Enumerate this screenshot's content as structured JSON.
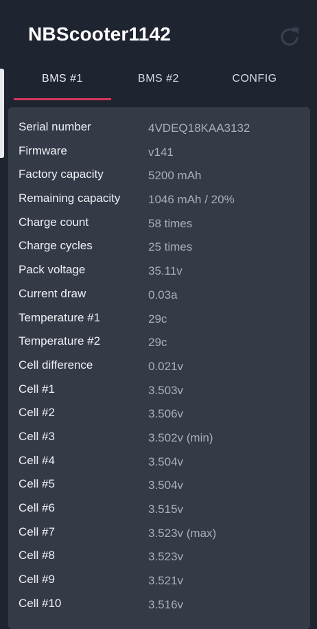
{
  "app": {
    "title": "NBScooter1142"
  },
  "header": {
    "refresh_icon": "refresh-icon"
  },
  "tabs": [
    {
      "label": "BMS #1",
      "active": true
    },
    {
      "label": "BMS #2",
      "active": false
    },
    {
      "label": "CONFIG",
      "active": false
    }
  ],
  "colors": {
    "background": "#1f2431",
    "card": "#353a47",
    "accent": "#d8385a",
    "label_text": "#eef0f4",
    "value_text": "#a9aeb9"
  },
  "bms": {
    "rows": [
      {
        "label": "Serial number",
        "value": "4VDEQ18KAA3132"
      },
      {
        "label": "Firmware",
        "value": "v141"
      },
      {
        "label": "Factory capacity",
        "value": "5200 mAh"
      },
      {
        "label": "Remaining capacity",
        "value": "1046 mAh / 20%"
      },
      {
        "label": "Charge count",
        "value": "58 times"
      },
      {
        "label": "Charge cycles",
        "value": "25 times"
      },
      {
        "label": "Pack voltage",
        "value": "35.11v"
      },
      {
        "label": "Current draw",
        "value": "0.03a"
      },
      {
        "label": "Temperature #1",
        "value": "29c"
      },
      {
        "label": "Temperature #2",
        "value": "29c"
      },
      {
        "label": "Cell difference",
        "value": "0.021v"
      },
      {
        "label": "Cell #1",
        "value": "3.503v"
      },
      {
        "label": "Cell #2",
        "value": "3.506v"
      },
      {
        "label": "Cell #3",
        "value": "3.502v (min)"
      },
      {
        "label": "Cell #4",
        "value": "3.504v"
      },
      {
        "label": "Cell #5",
        "value": "3.504v"
      },
      {
        "label": "Cell #6",
        "value": "3.515v"
      },
      {
        "label": "Cell #7",
        "value": "3.523v (max)"
      },
      {
        "label": "Cell #8",
        "value": "3.523v"
      },
      {
        "label": "Cell #9",
        "value": "3.521v"
      },
      {
        "label": "Cell #10",
        "value": "3.516v"
      }
    ]
  }
}
